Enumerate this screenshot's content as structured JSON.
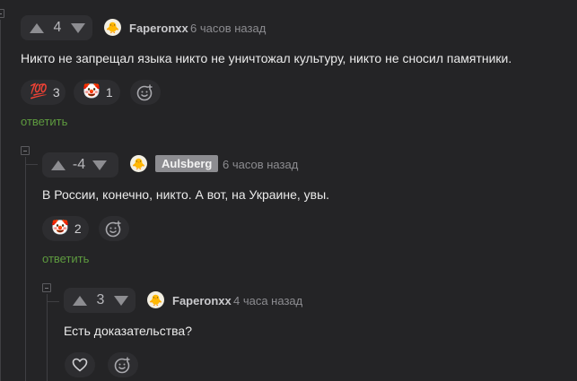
{
  "comments": [
    {
      "score": "4",
      "avatar_icon": "avatar-icon",
      "username": "Faperonxx",
      "time": "6 часов назад",
      "text": "Никто не запрещал языка никто не уничтожал культуру, никто не сносил памятники.",
      "reactions": [
        {
          "emoji": "💯",
          "icon": "hundred-points-icon",
          "count": "3"
        },
        {
          "emoji": "🤡",
          "icon": "clown-face-icon",
          "count": "1"
        }
      ],
      "reply_label": "ответить"
    },
    {
      "score": "-4",
      "avatar_icon": "avatar-icon",
      "username": "Aulsberg",
      "time": "6 часов назад",
      "text": "В России, конечно, никто. А вот, на Украине, увы.",
      "reactions": [
        {
          "emoji": "🤡",
          "icon": "clown-face-icon",
          "count": "2"
        }
      ],
      "reply_label": "ответить"
    },
    {
      "score": "3",
      "avatar_icon": "avatar-icon",
      "username": "Faperonxx",
      "time": "4 часа назад",
      "text": "Есть доказательства?",
      "reactions": []
    }
  ],
  "colors": {
    "background": "#242426",
    "reply_link": "#5e9b3f",
    "badge": "#8d8d91"
  }
}
